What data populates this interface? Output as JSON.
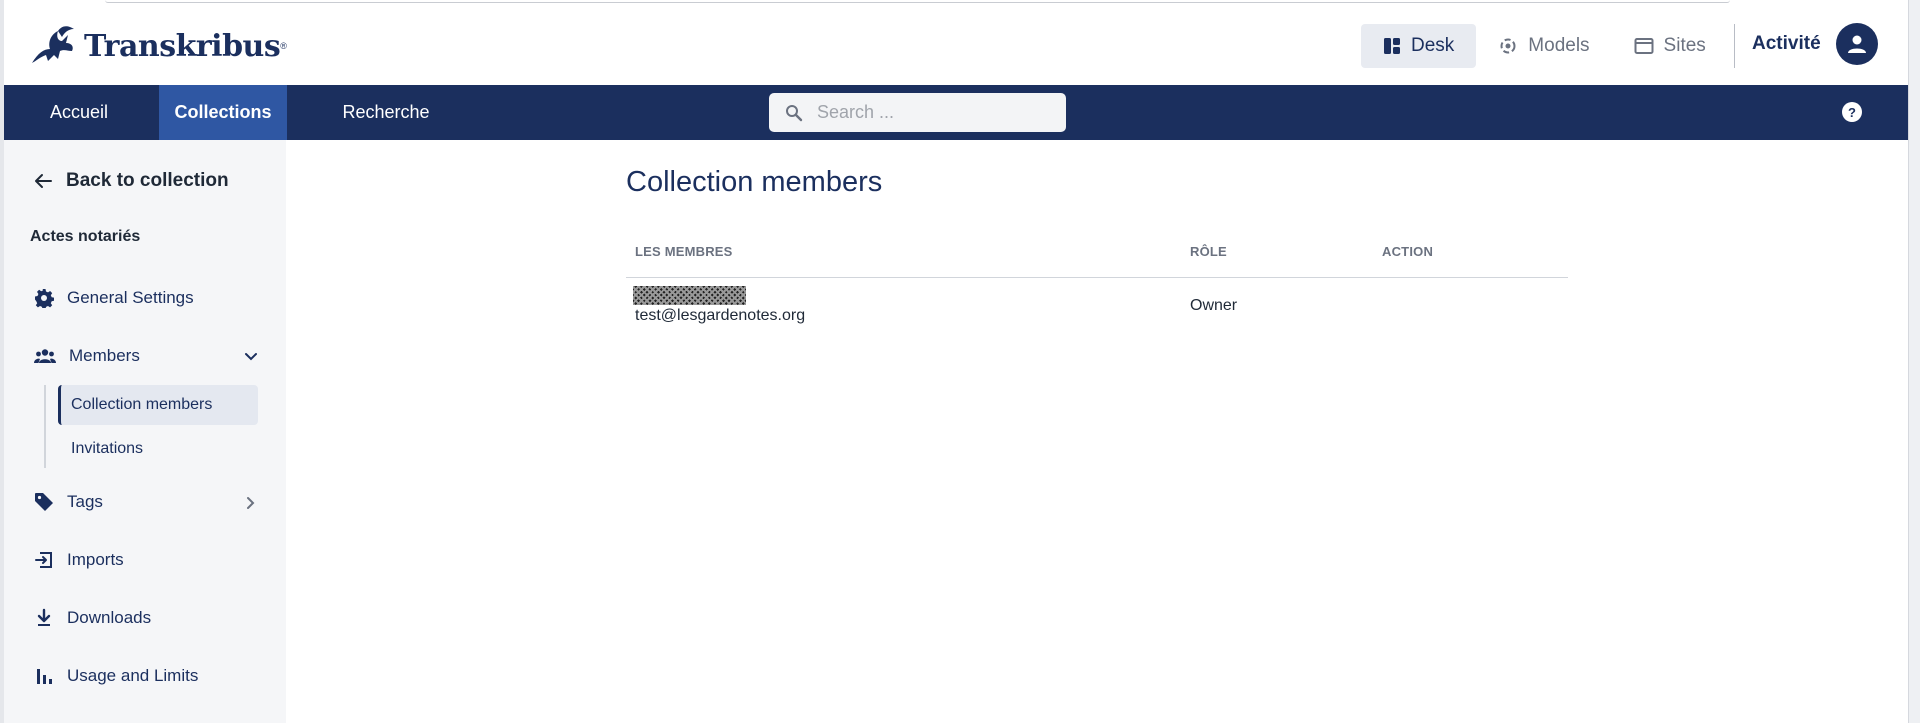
{
  "app": {
    "logo_text": "Transkribus",
    "logo_mark": "®"
  },
  "top_nav": {
    "items": [
      {
        "label": "Desk",
        "icon": "dashboard-icon",
        "active": true
      },
      {
        "label": "Models",
        "icon": "models-icon",
        "active": false
      },
      {
        "label": "Sites",
        "icon": "browser-window-icon",
        "active": false
      }
    ],
    "activity_label": "Activité",
    "avatar_icon": "user-avatar-icon"
  },
  "main_nav": {
    "items": [
      {
        "label": "Accueil",
        "active": false
      },
      {
        "label": "Collections",
        "active": true
      },
      {
        "label": "Recherche",
        "active": false
      }
    ],
    "search_placeholder": "Search ...",
    "help_label": "?"
  },
  "sidebar": {
    "back_label": "Back to collection",
    "collection_name": "Actes notariés",
    "items": [
      {
        "label": "General Settings",
        "icon": "gear-icon"
      },
      {
        "label": "Members",
        "icon": "group-icon",
        "expanded": true
      },
      {
        "label": "Tags",
        "icon": "tag-icon"
      },
      {
        "label": "Imports",
        "icon": "import-icon"
      },
      {
        "label": "Downloads",
        "icon": "download-icon"
      },
      {
        "label": "Usage and Limits",
        "icon": "bar-chart-icon"
      }
    ],
    "members_sub": [
      {
        "label": "Collection members",
        "active": true
      },
      {
        "label": "Invitations",
        "active": false
      }
    ]
  },
  "content": {
    "title": "Collection members",
    "columns": [
      "LES MEMBRES",
      "RÔLE",
      "ACTION"
    ],
    "rows": [
      {
        "name": "[redacted]",
        "email": "test@lesgardenotes.org",
        "role": "Owner",
        "action": ""
      }
    ]
  },
  "colors": {
    "brand_navy": "#1b2f5e",
    "active_tab": "#2f57a3",
    "sidebar_bg": "#f5f6f8"
  }
}
